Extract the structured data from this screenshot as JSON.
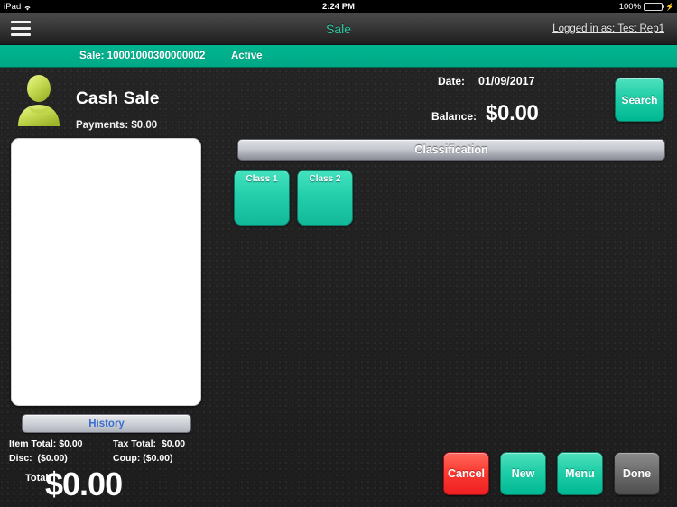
{
  "status_bar": {
    "carrier": "iPad",
    "wifi_icon": "wifi-icon",
    "time": "2:24 PM",
    "battery_percent": "100%",
    "battery_icon": "battery-icon",
    "charging_icon": "plug-icon"
  },
  "navbar": {
    "menu_icon": "hamburger-icon",
    "title": "Sale",
    "user_text": "Logged in as: Test Rep1",
    "title_color": "#2fc4a0"
  },
  "sale_bar": {
    "sale_id": "Sale: 10001000300000002",
    "status": "Active",
    "background_color": "#00b08c"
  },
  "customer": {
    "avatar_icon": "person-avatar-icon",
    "name": "Cash Sale",
    "payments": "Payments: $0.00"
  },
  "sale_info": {
    "date_label": "Date:",
    "date_value": "01/09/2017",
    "balance_label": "Balance:",
    "balance_value": "$0.00",
    "search_label": "Search"
  },
  "item_list": {
    "items": []
  },
  "history": {
    "label": "History",
    "text_color": "#3b6fd4"
  },
  "totals": {
    "item_total_label": "Item Total:",
    "item_total_value": "$0.00",
    "tax_total_label": "Tax Total:",
    "tax_total_value": "$0.00",
    "disc_label": "Disc:",
    "disc_value": "($0.00)",
    "coup_label": "Coup:",
    "coup_value": "($0.00)",
    "grand_label": "Total:",
    "grand_value": "$0.00"
  },
  "classification": {
    "header": "Classification",
    "tiles": [
      {
        "label": "Class 1"
      },
      {
        "label": "Class 2"
      }
    ]
  },
  "actions": {
    "cancel": "Cancel",
    "new": "New",
    "menu": "Menu",
    "done": "Done",
    "cancel_color": "#f5352f",
    "teal_color": "#00b894",
    "done_color": "#6e6e6e"
  }
}
